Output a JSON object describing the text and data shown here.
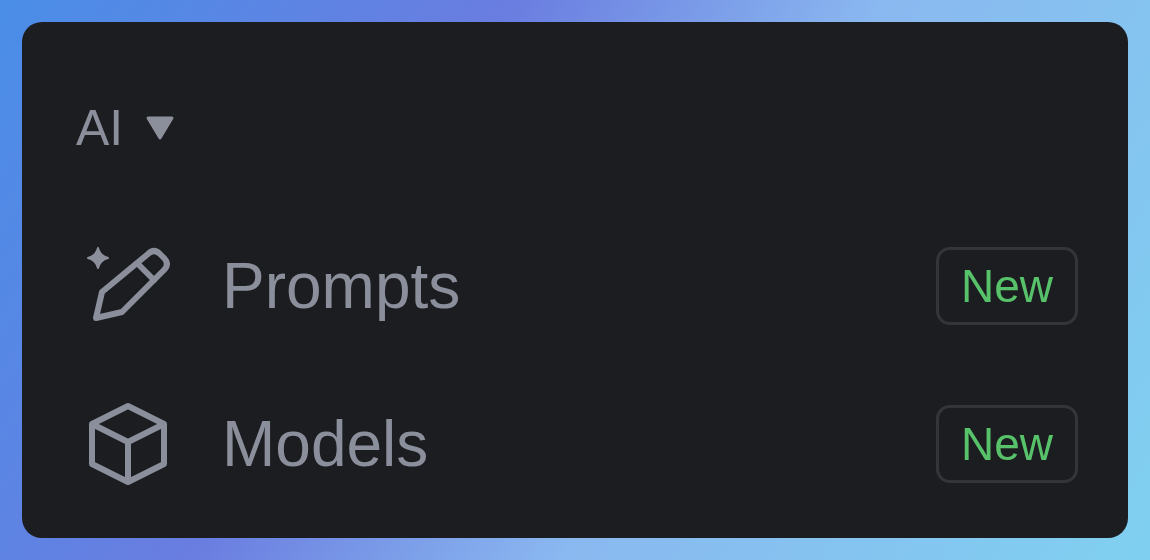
{
  "section": {
    "title": "AI",
    "expanded": true
  },
  "items": [
    {
      "label": "Prompts",
      "badge": "New"
    },
    {
      "label": "Models",
      "badge": "New"
    }
  ]
}
